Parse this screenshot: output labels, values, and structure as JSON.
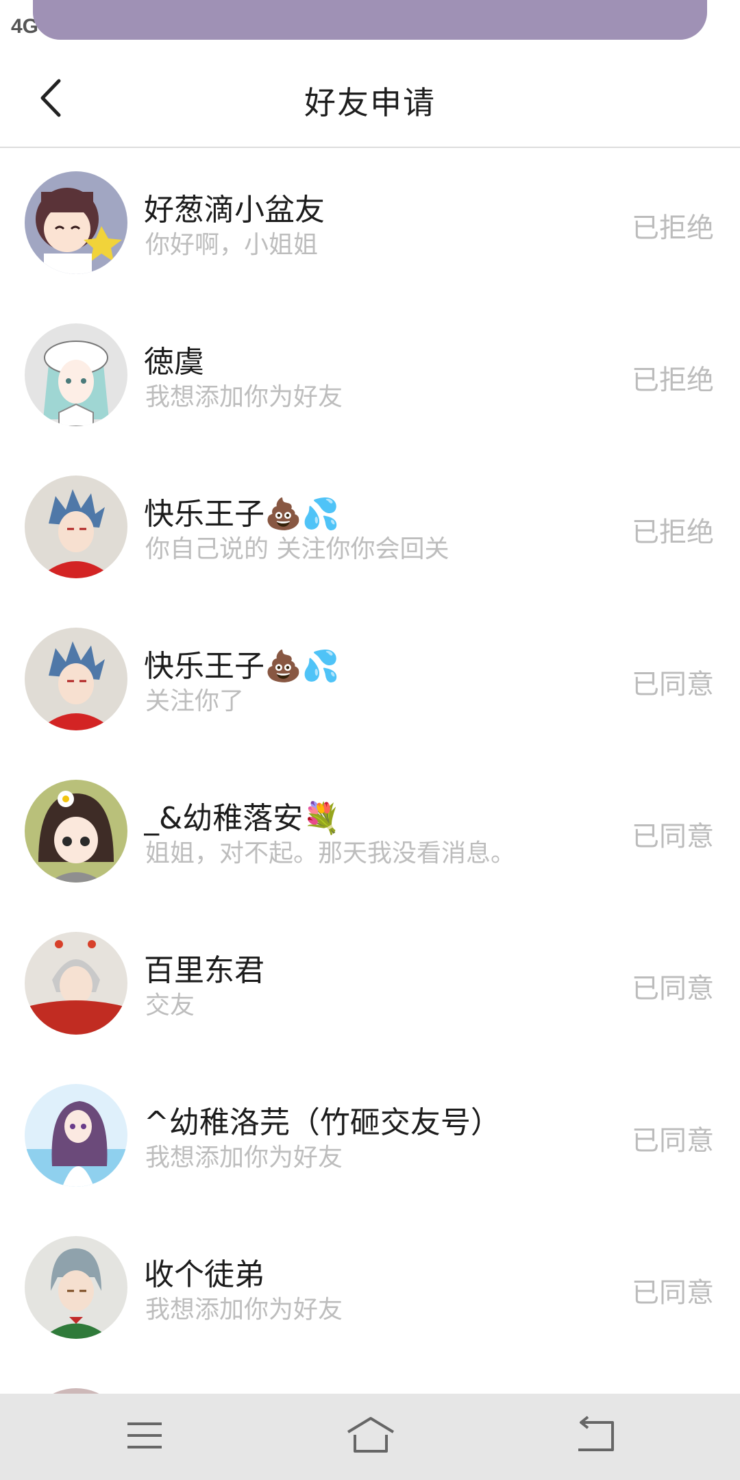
{
  "status_bar": {
    "network": "4G"
  },
  "header": {
    "title": "好友申请"
  },
  "requests": [
    {
      "name": "好葱滴小盆友",
      "message": "你好啊，小姐姐",
      "status": "已拒绝"
    },
    {
      "name": "徳虞",
      "message": "我想添加你为好友",
      "status": "已拒绝"
    },
    {
      "name": "快乐王子💩💦",
      "message": "你自己说的 关注你你会回关",
      "status": "已拒绝"
    },
    {
      "name": "快乐王子💩💦",
      "message": "关注你了",
      "status": "已同意"
    },
    {
      "name": "_&幼稚落安💐",
      "message": "姐姐，对不起。那天我没看消息。",
      "status": "已同意"
    },
    {
      "name": "百里东君",
      "message": "交友",
      "status": "已同意"
    },
    {
      "name": "^幼稚洛芫（竹砸交友号）",
      "message": "我想添加你为好友",
      "status": "已同意"
    },
    {
      "name": "收个徒弟",
      "message": "我想添加你为好友",
      "status": "已同意"
    }
  ],
  "nav": {
    "menu_icon": "menu-icon",
    "home_icon": "home-icon",
    "back_icon": "back-icon"
  }
}
